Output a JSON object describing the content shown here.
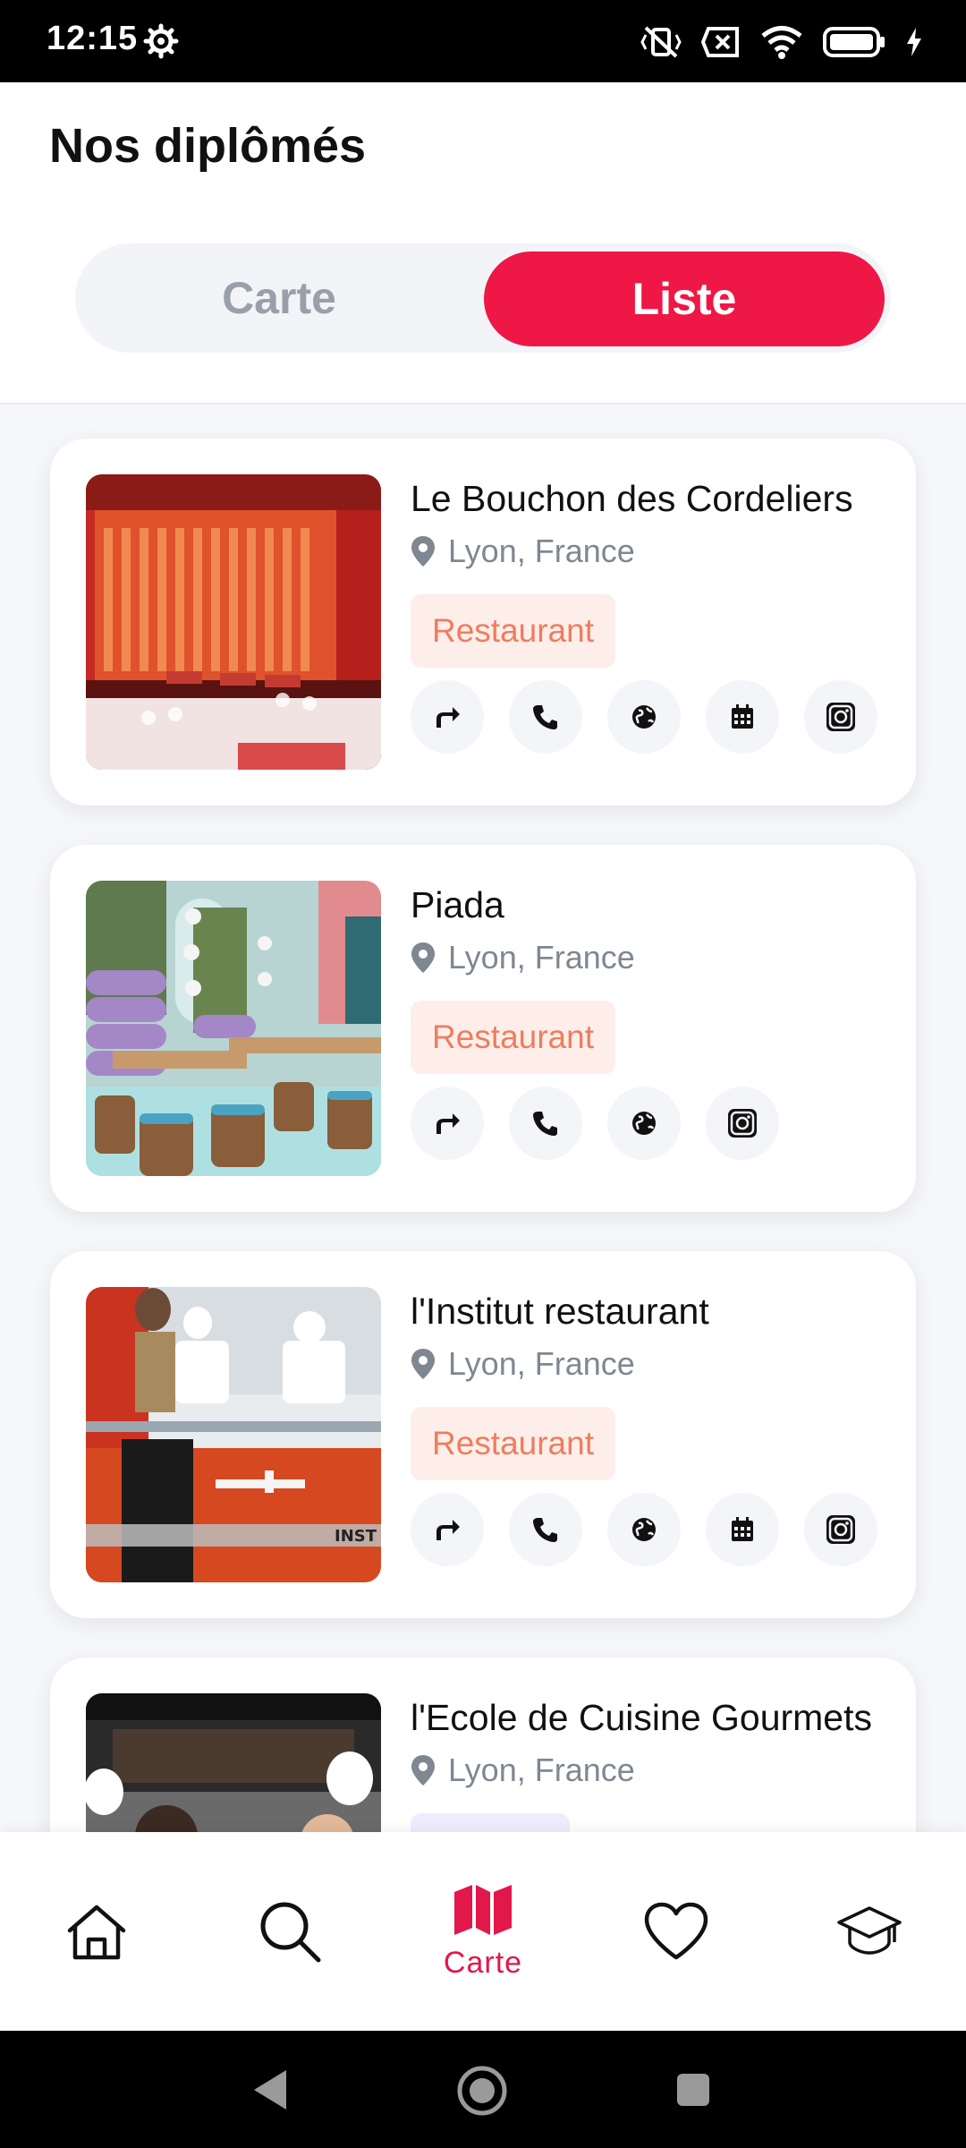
{
  "status_bar": {
    "time": "12:15",
    "icons": [
      "gear-icon",
      "vibrate-off-icon",
      "close-box-icon",
      "wifi-icon",
      "battery-icon",
      "charging-icon"
    ]
  },
  "header": {
    "title": "Nos diplômés",
    "toggle": {
      "left_label": "Carte",
      "right_label": "Liste",
      "selected": "Liste"
    }
  },
  "colors": {
    "accent": "#ee1745",
    "tag_bg": "#fdeeea",
    "tag_text": "#ee7d5e"
  },
  "listings": [
    {
      "name": "Le Bouchon des Cordeliers",
      "location": "Lyon, France",
      "category": "Restaurant",
      "actions": [
        "directions-icon",
        "phone-icon",
        "globe-icon",
        "calendar-icon",
        "instagram-icon"
      ]
    },
    {
      "name": "Piada",
      "location": "Lyon, France",
      "category": "Restaurant",
      "actions": [
        "directions-icon",
        "phone-icon",
        "globe-icon",
        "instagram-icon"
      ]
    },
    {
      "name": "l'Institut restaurant",
      "location": "Lyon, France",
      "category": "Restaurant",
      "actions": [
        "directions-icon",
        "phone-icon",
        "globe-icon",
        "calendar-icon",
        "instagram-icon"
      ]
    },
    {
      "name": "l'Ecole de Cuisine Gourmets",
      "location": "Lyon, France"
    }
  ],
  "bottom_nav": {
    "items": [
      {
        "icon": "home-icon",
        "label": ""
      },
      {
        "icon": "search-icon",
        "label": ""
      },
      {
        "icon": "map-icon",
        "label": "Carte",
        "active": true
      },
      {
        "icon": "heart-icon",
        "label": ""
      },
      {
        "icon": "graduation-cap-icon",
        "label": ""
      }
    ]
  }
}
